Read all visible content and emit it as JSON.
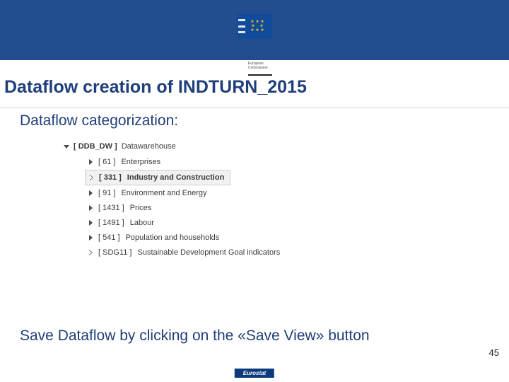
{
  "logo": {
    "line1": "European",
    "line2": "Commission"
  },
  "title": "Dataflow creation of INDTURN_2015",
  "subtitle": "Dataflow categorization:",
  "tree": {
    "root": {
      "code": "[ DDB_DW ]",
      "label": "Datawarehouse"
    },
    "items": [
      {
        "code": "[ 61 ]",
        "label": "Enterprises",
        "selected": false,
        "outline": false
      },
      {
        "code": "[ 331 ]",
        "label": "Industry and Construction",
        "selected": true,
        "outline": true
      },
      {
        "code": "[ 91 ]",
        "label": "Environment and Energy",
        "selected": false,
        "outline": false
      },
      {
        "code": "[ 1431 ]",
        "label": "Prices",
        "selected": false,
        "outline": false
      },
      {
        "code": "[ 1491 ]",
        "label": "Labour",
        "selected": false,
        "outline": false
      },
      {
        "code": "[ 541 ]",
        "label": "Population and households",
        "selected": false,
        "outline": false
      },
      {
        "code": "[ SDG11 ]",
        "label": "Sustainable Development Goal indicators",
        "selected": false,
        "outline": true
      }
    ]
  },
  "instruction": "Save Dataflow by clicking on the «Save View» button",
  "page_number": "45",
  "footer": "Eurostat"
}
